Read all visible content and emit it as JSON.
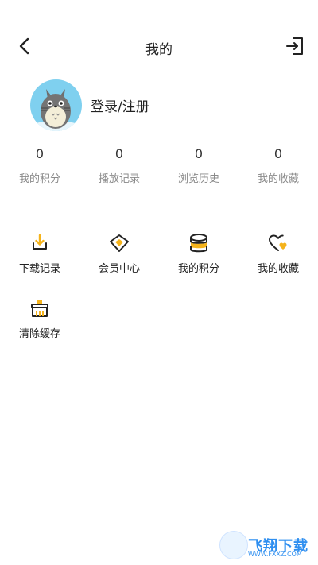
{
  "header": {
    "title": "我的"
  },
  "profile": {
    "login_text": "登录/注册"
  },
  "stats": [
    {
      "value": "0",
      "label": "我的积分"
    },
    {
      "value": "0",
      "label": "播放记录"
    },
    {
      "value": "0",
      "label": "浏览历史"
    },
    {
      "value": "0",
      "label": "我的收藏"
    }
  ],
  "menu": [
    {
      "icon": "download-icon",
      "label": "下载记录"
    },
    {
      "icon": "diamond-icon",
      "label": "会员中心"
    },
    {
      "icon": "coins-icon",
      "label": "我的积分"
    },
    {
      "icon": "heart-icon",
      "label": "我的收藏"
    },
    {
      "icon": "broom-icon",
      "label": "清除缓存"
    }
  ],
  "watermark": {
    "text": "飞翔下载",
    "sub": "WWW.FXXZ.COM"
  },
  "colors": {
    "accent": "#f5b31b",
    "text": "#222222",
    "muted": "#8a8a8a",
    "avatar_bg": "#7fd0ef"
  }
}
